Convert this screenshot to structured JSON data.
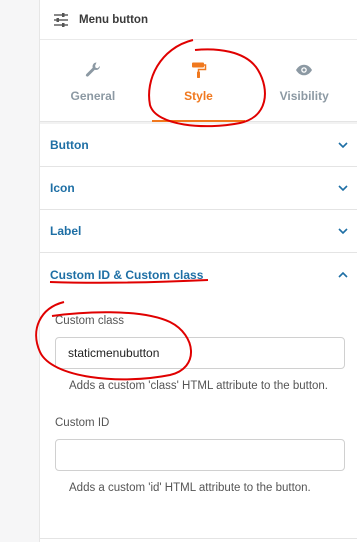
{
  "header": {
    "title": "Menu button",
    "icon": "sliders-icon"
  },
  "tabs": [
    {
      "label": "General",
      "icon": "wrench-icon",
      "active": false
    },
    {
      "label": "Style",
      "icon": "paint-roller-icon",
      "active": true
    },
    {
      "label": "Visibility",
      "icon": "eye-icon",
      "active": false
    }
  ],
  "sections": {
    "button": {
      "label": "Button"
    },
    "icon": {
      "label": "Icon"
    },
    "label": {
      "label": "Label"
    },
    "custom": {
      "label": "Custom ID & Custom class"
    }
  },
  "custom_class": {
    "label": "Custom class",
    "value": "staticmenubutton",
    "help": "Adds a custom 'class' HTML attribute to the button."
  },
  "custom_id": {
    "label": "Custom ID",
    "value": "",
    "help": "Adds a custom 'id' HTML attribute to the button."
  },
  "colors": {
    "accent": "#f0781e",
    "link": "#1e6fa5",
    "muted_tab": "#8c99a3",
    "annotation": "#e00000"
  }
}
